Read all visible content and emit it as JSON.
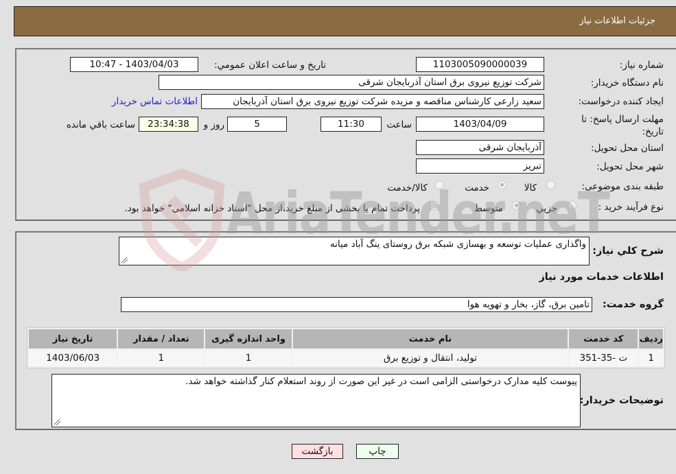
{
  "header": {
    "title": "جزئیات اطلاعات نیاز"
  },
  "details": {
    "need_number": {
      "label": "شماره نیاز:",
      "value": "1103005090000039"
    },
    "announce_datetime": {
      "label": "تاریخ و ساعت اعلان عمومي:",
      "value": "1403/04/03 - 10:47"
    },
    "buyer_org": {
      "label": "نام دستگاه خریدار:",
      "value": "شرکت توزیع نیروی برق استان آذربایجان شرقی"
    },
    "requester": {
      "label": "ایجاد کننده درخواست:",
      "value": "سعید زارعی کارشناس مناقصه و مزیده شرکت توزیع نیروی برق استان آذربایجان"
    },
    "buyer_contact_link": "اطلاعات تماس خریدار",
    "deadline": {
      "label": "مهلت ارسال پاسخ: تا تاریخ:",
      "date": "1403/04/09",
      "time_label": "ساعت",
      "time": "11:30",
      "days": "5",
      "days_label": "روز و",
      "remaining": "23:34:38",
      "remaining_label": "ساعت باقي مانده"
    },
    "delivery_province": {
      "label": "استان محل تحویل:",
      "value": "آذربایجان شرقی"
    },
    "delivery_city": {
      "label": "شهر محل تحویل:",
      "value": "تبریز"
    },
    "category": {
      "label": "طبقه بندی موضوعی:",
      "options": [
        "کالا",
        "خدمت",
        "کالا/خدمت"
      ],
      "selected": "خدمت"
    },
    "purchase_type": {
      "label": "نوع فرآیند خرید :",
      "options": [
        "جزیي",
        "متوسط"
      ],
      "selected": "متوسط",
      "treasury_note": "پرداخت تمام یا بخشی از مبلغ خرید،از محل \"اسناد خزانه اسلامی\" خواهد بود."
    }
  },
  "summary": {
    "label": "شرح کلي نیاز:",
    "value": "واگذاری عملیات توسعه و بهسازی شبکه برق روستای ینگ آباد میانه"
  },
  "services_section": {
    "title": "اطلاعات خدمات مورد نیاز",
    "group_label": "گروه خدمت:",
    "group_value": "تامین برق، گاز، بخار و تهویه هوا",
    "table": {
      "headers": [
        "ردیف",
        "کد خدمت",
        "نام خدمت",
        "واحد اندازه گیری",
        "تعداد / مقدار",
        "تاریخ نیاز"
      ],
      "rows": [
        [
          "1",
          "ت -35-351",
          "تولید، انتقال و توزیع برق",
          "1",
          "1",
          "1403/06/03"
        ]
      ]
    }
  },
  "buyer_notes": {
    "label": "توضیحات خریدار:",
    "value": "پیوست کلیه مدارک درخواستی الزامی است در غیر این صورت از روند استعلام کنار گذاشته خواهد شد."
  },
  "buttons": {
    "print": "چاپ",
    "back": "بازگشت"
  },
  "watermark": "AriaTender.neT"
}
